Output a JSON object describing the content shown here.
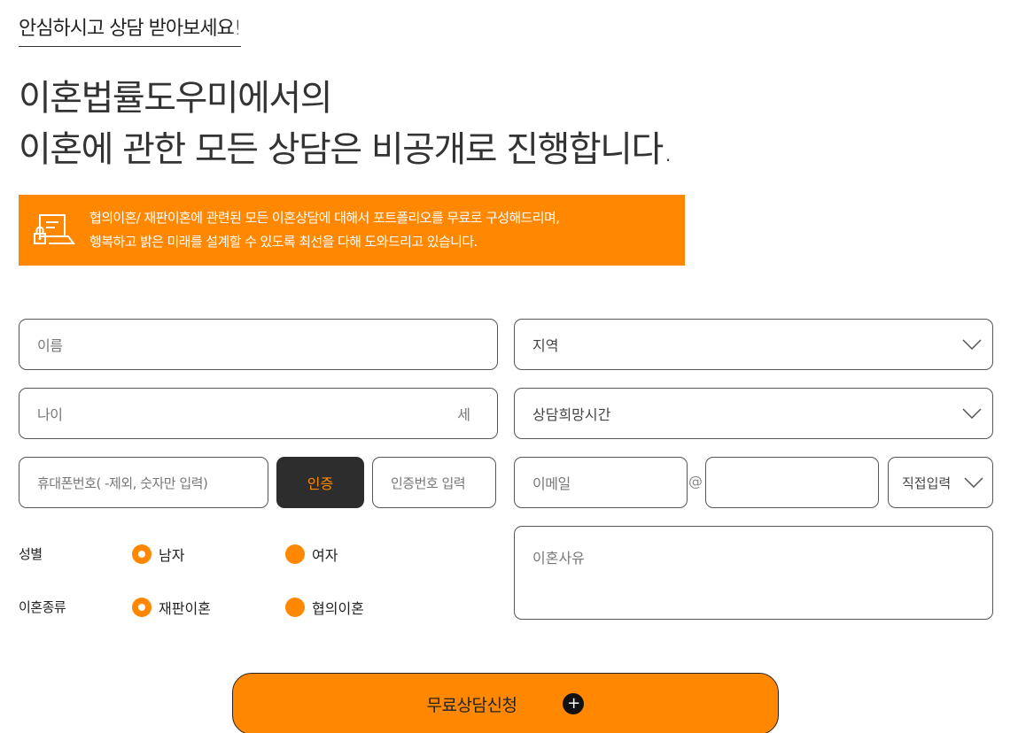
{
  "header": {
    "subtitle": "안심하시고 상담 받아보세요!",
    "headline_line1": "이혼법률도우미에서의",
    "headline_line2": "이혼에 관한 모든 상담은 비공개로 진행합니다."
  },
  "notice": {
    "icon": "laptop-lock-icon",
    "line1": "협의이혼/ 재판이혼에 관련된 모든 이혼상담에 대해서 포트폴리오를 무료로 구성해드리며,",
    "line2": "행복하고 밝은 미래를 설계할 수 있도록 최선을 다해 도와드리고 있습니다."
  },
  "form": {
    "name_placeholder": "이름",
    "region_placeholder": "지역",
    "age_placeholder": "나이",
    "age_unit": "세",
    "time_placeholder": "상담희망시간",
    "phone_placeholder": "휴대폰번호( -제외, 숫자만 입력)",
    "cert_button": "인증",
    "cert_code_placeholder": "인증번호 입력",
    "email_placeholder": "이메일",
    "email_at": "@",
    "email_domain_select": "직접입력",
    "gender_label": "성별",
    "gender_options": [
      "남자",
      "여자"
    ],
    "gender_selected": "남자",
    "type_label": "이혼종류",
    "type_options": [
      "재판이혼",
      "협의이혼"
    ],
    "type_selected": "재판이혼",
    "reason_placeholder": "이혼사유",
    "submit_label": "무료상담신청",
    "submit_icon": "plus-circle-icon"
  },
  "colors": {
    "accent": "#ff8800",
    "dark_button": "#2d2d2d"
  }
}
